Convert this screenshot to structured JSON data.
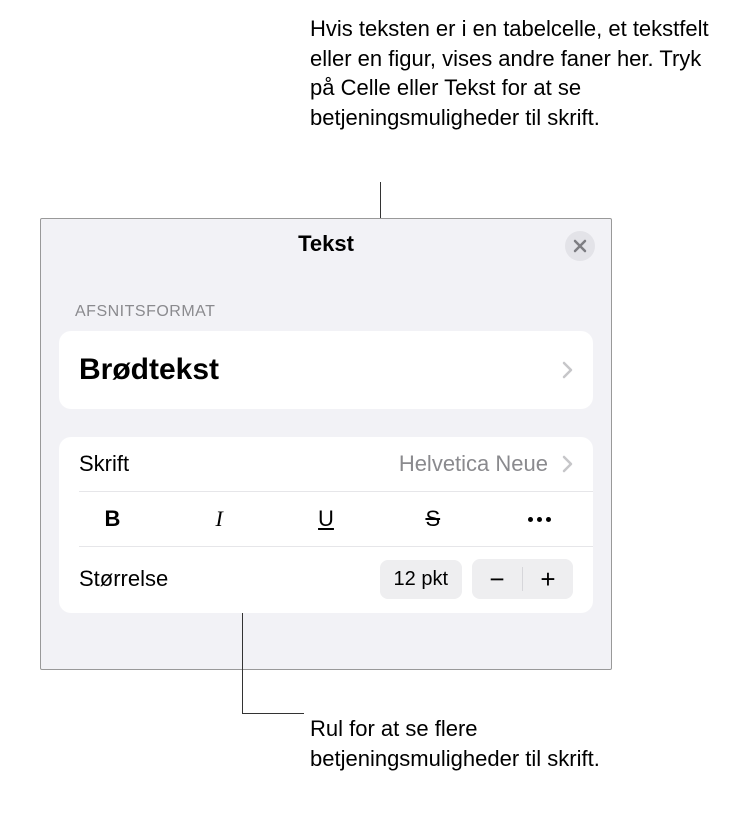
{
  "annotations": {
    "top": "Hvis teksten er i en tabelcelle, et tekstfelt eller en figur, vises andre faner her. Tryk på Celle eller Tekst for at se betjeningsmuligheder til skrift.",
    "bottom": "Rul for at se flere betjeningsmuligheder til skrift."
  },
  "panel": {
    "title": "Tekst",
    "section_label": "AFSNITSFORMAT",
    "paragraph_style": "Brødtekst",
    "font": {
      "label": "Skrift",
      "value": "Helvetica Neue"
    },
    "styles": {
      "bold": "B",
      "italic": "I",
      "underline": "U",
      "strike": "S"
    },
    "size": {
      "label": "Størrelse",
      "value": "12 pkt",
      "minus": "−",
      "plus": "+"
    }
  }
}
